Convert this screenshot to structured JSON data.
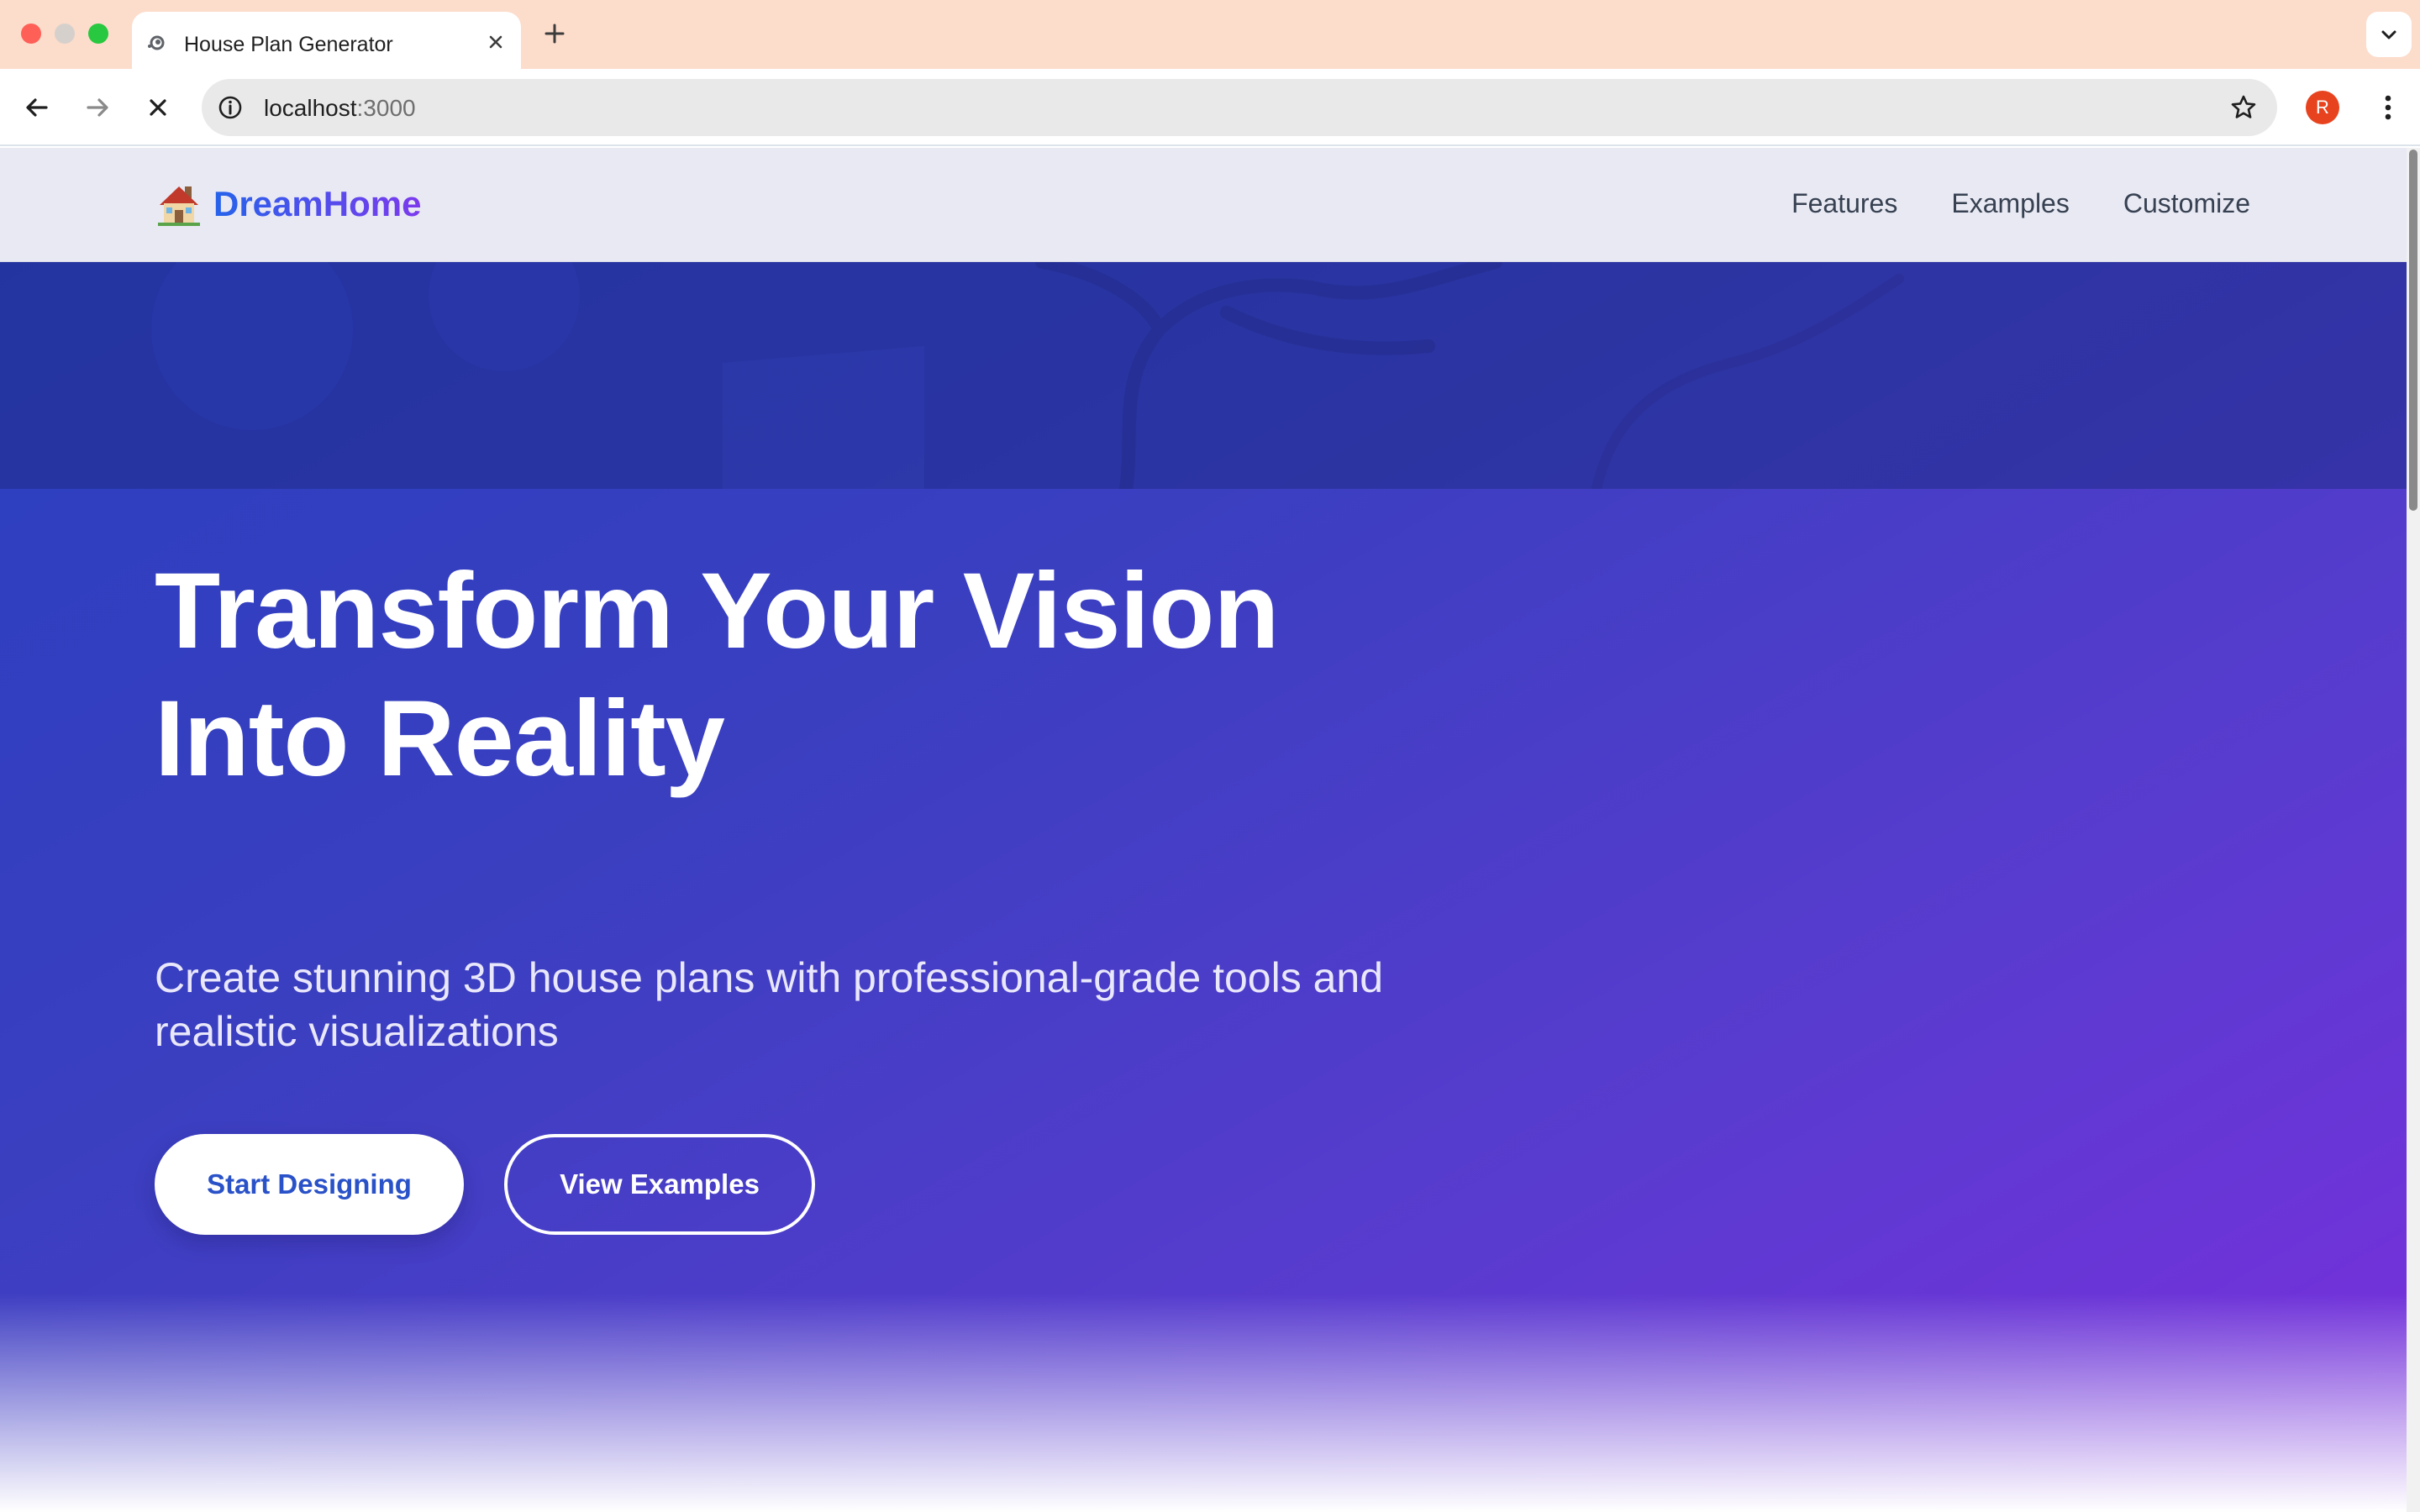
{
  "browser": {
    "tab_title": "House Plan Generator",
    "url_host": "localhost",
    "url_port": ":3000",
    "profile_initial": "R"
  },
  "site": {
    "logo_text": "DreamHome",
    "nav": [
      "Features",
      "Examples",
      "Customize"
    ]
  },
  "hero": {
    "title_line1": "Transform Your Vision",
    "title_line2": "Into Reality",
    "subtitle": "Create stunning 3D house plans with professional-grade tools and realistic visualizations",
    "primary_button": "Start Designing",
    "secondary_button": "View Examples"
  },
  "colors": {
    "tabbar": "#fcdccb",
    "hero_start": "#2a3fbf",
    "hero_end": "#7a2fdd",
    "logo_gradient_start": "#2563eb",
    "logo_gradient_end": "#7c3aed",
    "profile": "#e8431f"
  }
}
